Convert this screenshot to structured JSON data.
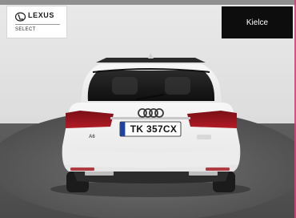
{
  "dealer": {
    "brand_name": "LEXUS",
    "brand_sub": "SELECT"
  },
  "location_badge": {
    "label": "Kielce"
  },
  "vehicle": {
    "plate": "TK 357CX",
    "model_badge": "A6"
  },
  "colors": {
    "badge_bg": "#0d0d0d",
    "car_body": "#f3f3f3",
    "accent_edge": "#e23a7a"
  }
}
